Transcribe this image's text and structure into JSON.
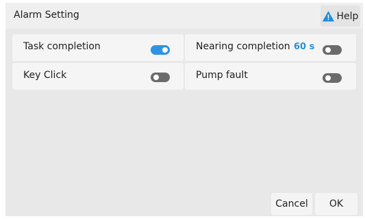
{
  "dialog": {
    "title": "Alarm Setting",
    "help": {
      "label": "Help",
      "icon": "warning-triangle-icon",
      "icon_color": "#1e8ce0"
    }
  },
  "settings": [
    {
      "label": "Task completion",
      "enabled": true
    },
    {
      "label": "Nearing completion",
      "value": "60 s",
      "enabled": false
    },
    {
      "label": "Key Click",
      "enabled": false
    },
    {
      "label": "Pump fault",
      "enabled": false
    }
  ],
  "footer": {
    "cancel_label": "Cancel",
    "ok_label": "OK"
  },
  "colors": {
    "accent": "#2f93e3",
    "toggle_off": "#6b6b6b",
    "value_text": "#2d8fd8"
  }
}
